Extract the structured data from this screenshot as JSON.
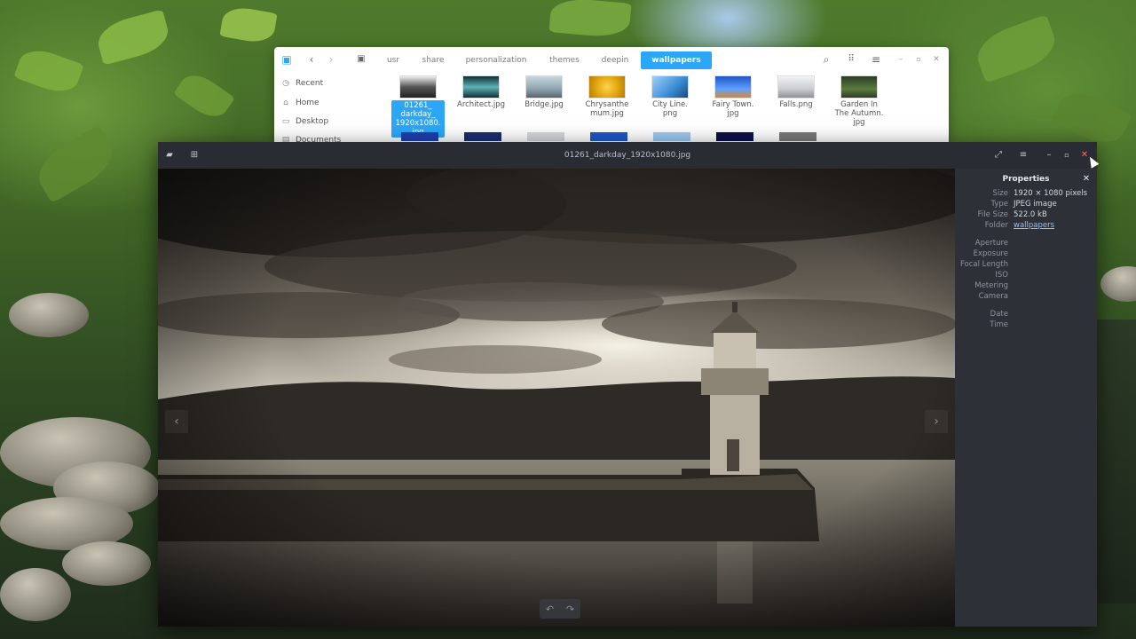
{
  "file_manager": {
    "breadcrumbs": [
      "usr",
      "share",
      "personalization",
      "themes",
      "deepin",
      "wallpapers"
    ],
    "active_crumb": "wallpapers",
    "sidebar": [
      {
        "label": "Recent",
        "icon": "clock-icon"
      },
      {
        "label": "Home",
        "icon": "home-icon"
      },
      {
        "label": "Desktop",
        "icon": "desktop-icon"
      },
      {
        "label": "Documents",
        "icon": "document-icon"
      }
    ],
    "files": [
      {
        "name": "01261_\ndarkday_\n1920x1080.\njpg",
        "selected": true,
        "thumb": "#6b6b6b"
      },
      {
        "name": "Architect.jpg",
        "selected": false,
        "thumb": "#2b6b6a"
      },
      {
        "name": "Bridge.jpg",
        "selected": false,
        "thumb": "#8aa0ad"
      },
      {
        "name": "Chrysanthe\nmum.jpg",
        "selected": false,
        "thumb": "#e3a814"
      },
      {
        "name": "City Line.\npng",
        "selected": false,
        "thumb": "#3a8ad0"
      },
      {
        "name": "Fairy Town.\njpg",
        "selected": false,
        "thumb": "#2a6bd1"
      },
      {
        "name": "Falls.png",
        "selected": false,
        "thumb": "#c9cbcf"
      },
      {
        "name": "Garden In\nThe Autumn.\njpg",
        "selected": false,
        "thumb": "#3e5a2f"
      }
    ]
  },
  "viewer": {
    "title": "01261_darkday_1920x1080.jpg",
    "properties": {
      "title": "Properties",
      "rows": [
        {
          "key": "Size",
          "value": "1920 × 1080 pixels"
        },
        {
          "key": "Type",
          "value": "JPEG image"
        },
        {
          "key": "File Size",
          "value": "522.0 kB"
        },
        {
          "key": "Folder",
          "value": "wallpapers",
          "link": true
        },
        {
          "key": "Aperture",
          "value": ""
        },
        {
          "key": "Exposure",
          "value": ""
        },
        {
          "key": "Focal Length",
          "value": ""
        },
        {
          "key": "ISO",
          "value": ""
        },
        {
          "key": "Metering",
          "value": ""
        },
        {
          "key": "Camera",
          "value": ""
        },
        {
          "key": "Date",
          "value": ""
        },
        {
          "key": "Time",
          "value": ""
        }
      ]
    }
  },
  "colors": {
    "accent": "#2ca7f8",
    "viewer_bg": "#23252b",
    "panel_bg": "#2e3038"
  }
}
